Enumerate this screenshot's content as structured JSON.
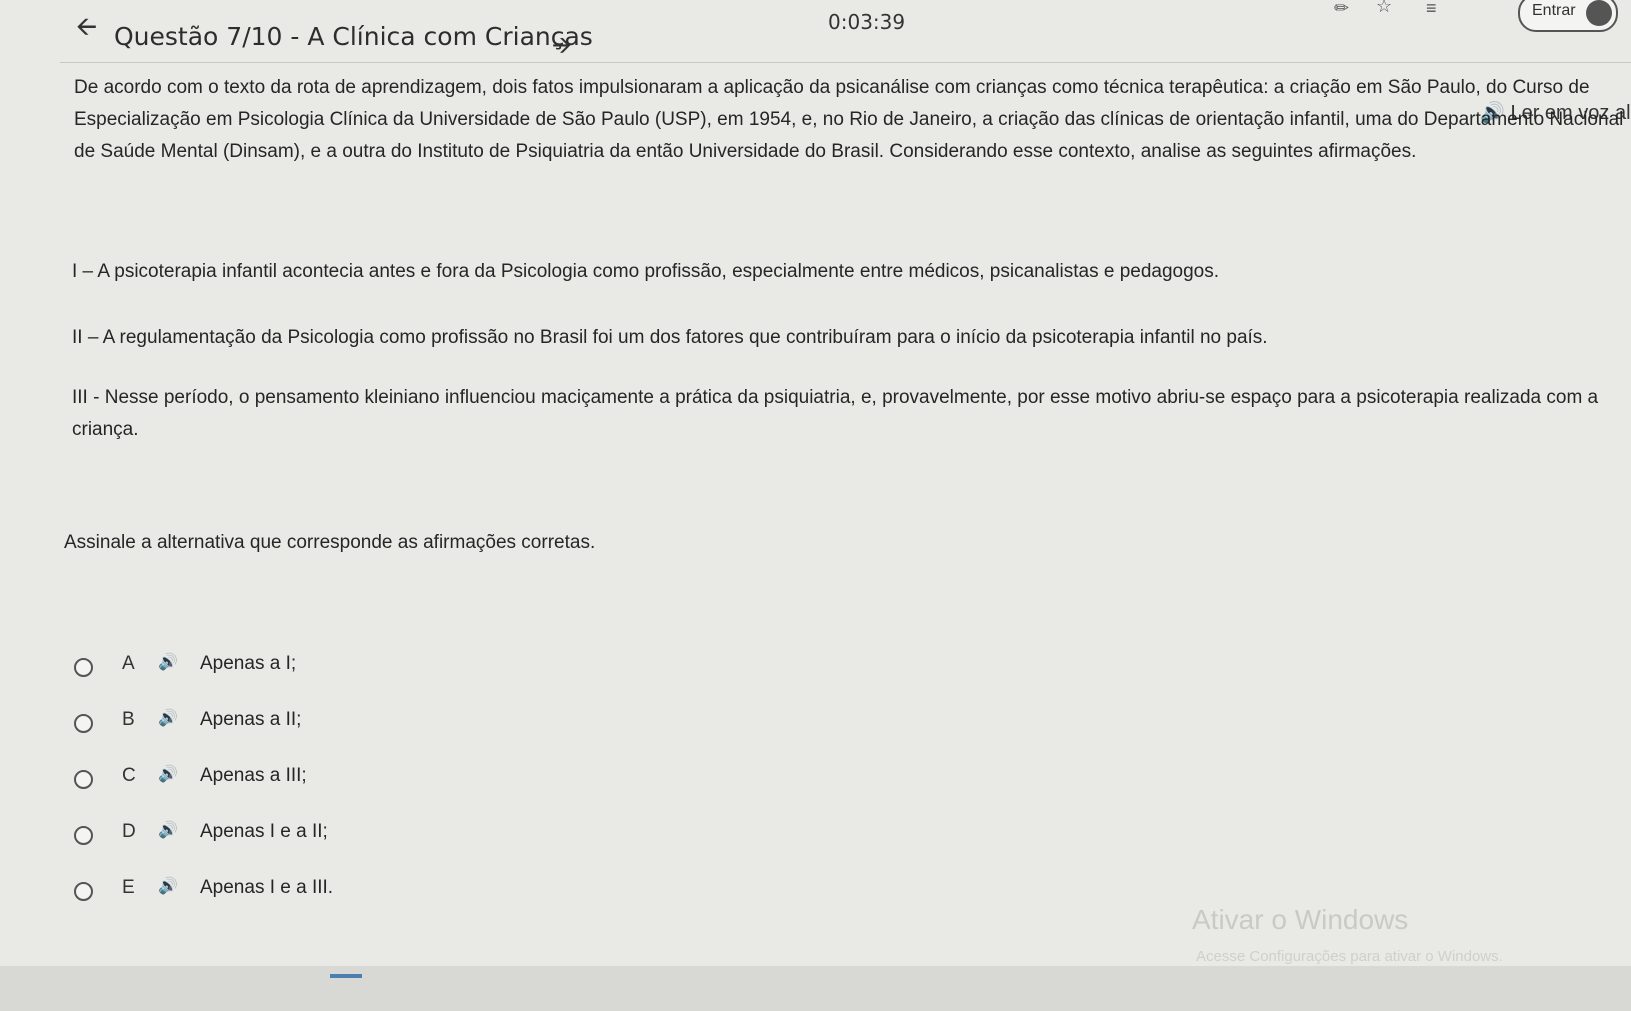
{
  "header": {
    "back_icon": "arrow-left-icon",
    "title": "Questão 7/10 - A Clínica com Crianças",
    "next_icon": "arrow-right-icon",
    "timer": "0:03:39",
    "login_label": "Entrar"
  },
  "read_aloud": "🔊 Ler em voz al",
  "question": {
    "text": "De acordo com o texto da rota de aprendizagem, dois fatos impulsionaram a aplicação da psicanálise com crianças como técnica terapêutica: a criação em São Paulo, do Curso de Especialização em Psicologia Clínica da Universidade de São Paulo (USP), em 1954, e, no Rio de Janeiro, a criação das clínicas de orientação infantil, uma do Departamento Nacional de Saúde Mental (Dinsam), e a outra do Instituto de Psiquiatria da então Universidade do Brasil. Considerando esse contexto, analise as seguintes afirmações.",
    "statements": [
      "I – A psicoterapia infantil acontecia antes e fora da Psicologia como profissão, especialmente entre médicos, psicanalistas e pedagogos.",
      "II – A regulamentação da Psicologia como profissão no Brasil foi um dos fatores que contribuíram para o início da psicoterapia infantil no país.",
      "III - Nesse período, o pensamento kleiniano influenciou maciçamente a prática da psiquiatria, e, provavelmente, por esse motivo abriu-se espaço para a psicoterapia realizada com a criança."
    ],
    "prompt": "Assinale a alternativa que corresponde as afirmações corretas."
  },
  "options": [
    {
      "letter": "A",
      "text": "Apenas a I;"
    },
    {
      "letter": "B",
      "text": "Apenas a II;"
    },
    {
      "letter": "C",
      "text": "Apenas a III;"
    },
    {
      "letter": "D",
      "text": "Apenas I e a II;"
    },
    {
      "letter": "E",
      "text": "Apenas I e a III."
    }
  ],
  "audio_icon": "🔊",
  "watermark": {
    "line1": "Ativar o Windows",
    "line2": "Acesse Configurações para ativar o Windows."
  }
}
